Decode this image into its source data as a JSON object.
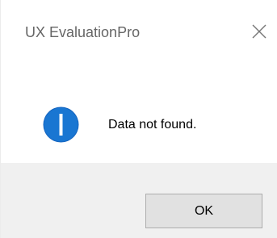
{
  "window": {
    "title": "UX EvaluationPro",
    "close_icon": "close-icon"
  },
  "message": {
    "icon": "info-icon",
    "text": "Data not found.",
    "icon_color": "#1565c0"
  },
  "buttons": {
    "ok_label": "OK"
  }
}
